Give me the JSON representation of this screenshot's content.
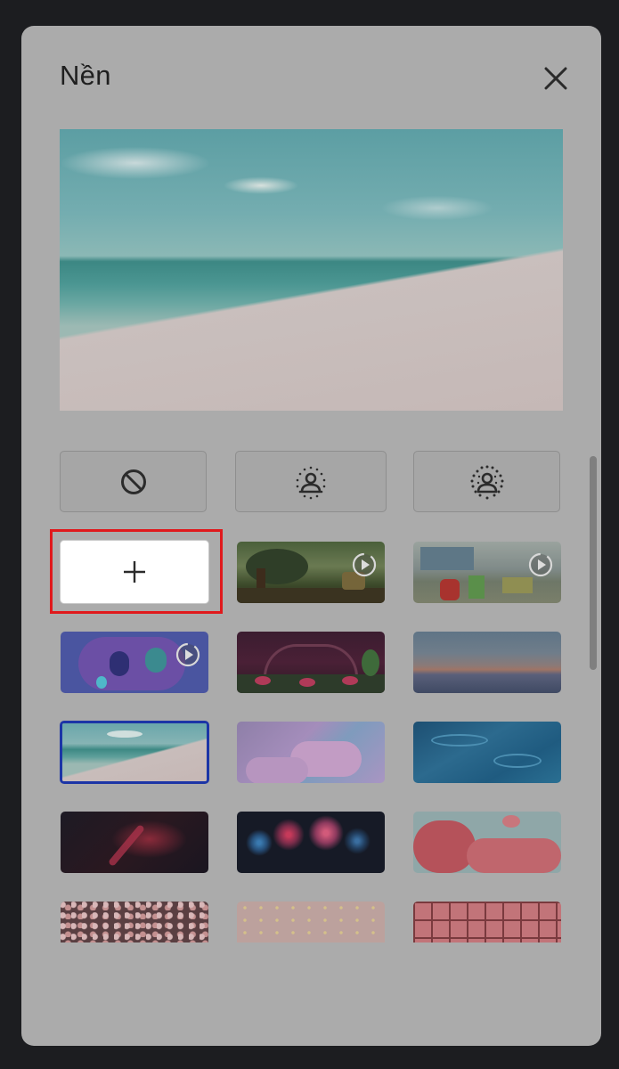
{
  "dialog": {
    "title": "Nền",
    "close_icon": "close-icon"
  },
  "preview": {
    "image": "beach-background-preview"
  },
  "options": [
    {
      "name": "no-effect",
      "icon": "no-effect-icon"
    },
    {
      "name": "slight-blur",
      "icon": "slight-blur-icon"
    },
    {
      "name": "blur",
      "icon": "blur-icon"
    }
  ],
  "add_button": {
    "icon": "plus-icon"
  },
  "backgrounds": [
    {
      "name": "forest-animated",
      "animated": true
    },
    {
      "name": "classroom-animated",
      "animated": true
    },
    {
      "name": "purple-room-animated",
      "animated": true
    },
    {
      "name": "night-garden",
      "animated": false
    },
    {
      "name": "sunset-horizon",
      "animated": false
    },
    {
      "name": "beach",
      "animated": false,
      "selected": true
    },
    {
      "name": "pink-clouds",
      "animated": false
    },
    {
      "name": "water-ripples",
      "animated": false
    },
    {
      "name": "red-nebula",
      "animated": false
    },
    {
      "name": "fireworks",
      "animated": false
    },
    {
      "name": "pink-blossoms",
      "animated": false
    },
    {
      "name": "flower-field",
      "animated": false
    },
    {
      "name": "pink-sparkles",
      "animated": false
    },
    {
      "name": "pink-tiles",
      "animated": false
    }
  ],
  "colors": {
    "selected_border": "#1c35a6",
    "highlight_frame": "#e0191c"
  }
}
